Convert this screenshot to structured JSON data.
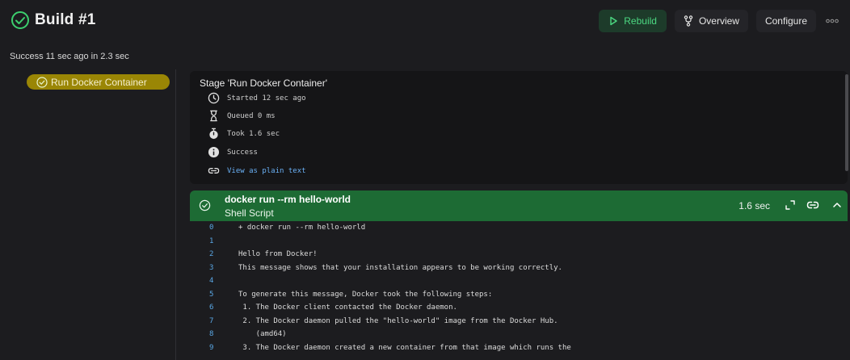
{
  "header": {
    "title": "Build #1",
    "rebuild_label": "Rebuild",
    "overview_label": "Overview",
    "configure_label": "Configure"
  },
  "status_line": "Success 11 sec ago in 2.3 sec",
  "sidebar": {
    "stage_label": "Run Docker Container"
  },
  "stage": {
    "title": "Stage 'Run Docker Container'",
    "started": "Started 12 sec ago",
    "queued": "Queued 0 ms",
    "took": "Took 1.6 sec",
    "status": "Success",
    "plain_text_link": "View as plain text"
  },
  "step": {
    "command": "docker run --rm hello-world",
    "type": "Shell Script",
    "duration": "1.6 sec"
  },
  "log": [
    {
      "n": "0",
      "text": "+ docker run --rm hello-world"
    },
    {
      "n": "1",
      "text": ""
    },
    {
      "n": "2",
      "text": "Hello from Docker!"
    },
    {
      "n": "3",
      "text": "This message shows that your installation appears to be working correctly."
    },
    {
      "n": "4",
      "text": ""
    },
    {
      "n": "5",
      "text": "To generate this message, Docker took the following steps:"
    },
    {
      "n": "6",
      "text": " 1. The Docker client contacted the Docker daemon."
    },
    {
      "n": "7",
      "text": " 2. The Docker daemon pulled the \"hello-world\" image from the Docker Hub."
    },
    {
      "n": "8",
      "text": "    (amd64)"
    },
    {
      "n": "9",
      "text": " 3. The Docker daemon created a new container from that image which runs the"
    }
  ],
  "colors": {
    "success_green": "#1d6b34",
    "stage_pill": "#9a8605",
    "link_blue": "#6ab0f5",
    "rebuild_green": "#4cd982"
  }
}
